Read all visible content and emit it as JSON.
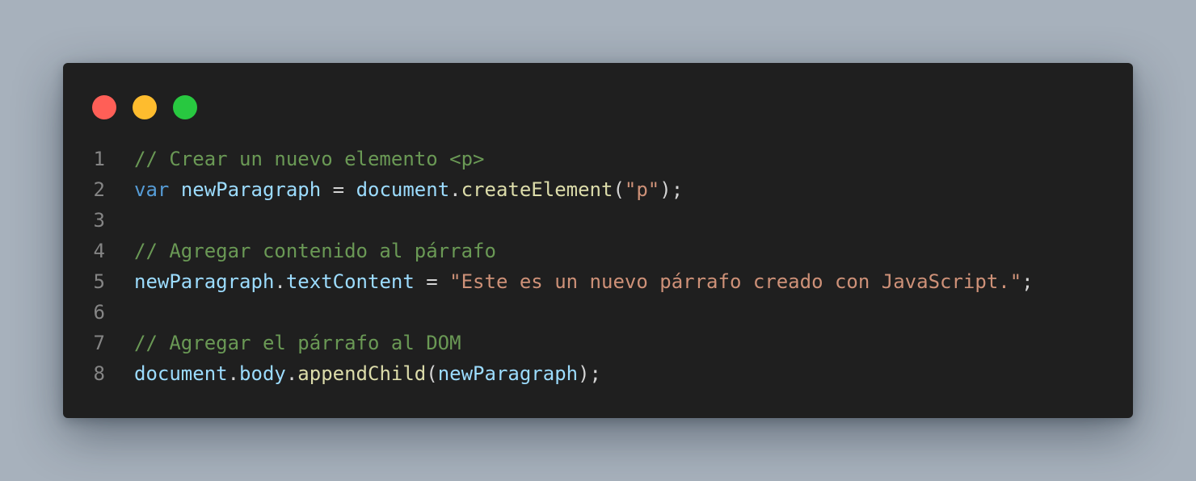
{
  "colors": {
    "background": "#a7b1bc",
    "window": "#1f1f1f",
    "dot_close": "#ff5f57",
    "dot_minimize": "#febc2e",
    "dot_maximize": "#28c840",
    "comment": "#6a9955",
    "keyword": "#569cd6",
    "variable": "#9cdcfe",
    "function": "#dcdcaa",
    "string": "#ce9178",
    "punctuation": "#d4d4d4",
    "line_number": "#858585"
  },
  "window_controls": [
    {
      "name": "close",
      "color": "#ff5f57"
    },
    {
      "name": "minimize",
      "color": "#febc2e"
    },
    {
      "name": "maximize",
      "color": "#28c840"
    }
  ],
  "code_lines": [
    {
      "number": "1",
      "tokens": [
        {
          "type": "comment",
          "text": "// Crear un nuevo elemento <p>"
        }
      ]
    },
    {
      "number": "2",
      "tokens": [
        {
          "type": "keyword",
          "text": "var"
        },
        {
          "type": "punct",
          "text": " "
        },
        {
          "type": "variable",
          "text": "newParagraph"
        },
        {
          "type": "punct",
          "text": " = "
        },
        {
          "type": "variable",
          "text": "document"
        },
        {
          "type": "punct",
          "text": "."
        },
        {
          "type": "function",
          "text": "createElement"
        },
        {
          "type": "punct",
          "text": "("
        },
        {
          "type": "string",
          "text": "\"p\""
        },
        {
          "type": "punct",
          "text": ");"
        }
      ]
    },
    {
      "number": "3",
      "tokens": []
    },
    {
      "number": "4",
      "tokens": [
        {
          "type": "comment",
          "text": "// Agregar contenido al párrafo"
        }
      ]
    },
    {
      "number": "5",
      "tokens": [
        {
          "type": "variable",
          "text": "newParagraph"
        },
        {
          "type": "punct",
          "text": "."
        },
        {
          "type": "variable",
          "text": "textContent"
        },
        {
          "type": "punct",
          "text": " = "
        },
        {
          "type": "string",
          "text": "\"Este es un nuevo párrafo creado con JavaScript.\""
        },
        {
          "type": "punct",
          "text": ";"
        }
      ]
    },
    {
      "number": "6",
      "tokens": []
    },
    {
      "number": "7",
      "tokens": [
        {
          "type": "comment",
          "text": "// Agregar el párrafo al DOM"
        }
      ]
    },
    {
      "number": "8",
      "tokens": [
        {
          "type": "variable",
          "text": "document"
        },
        {
          "type": "punct",
          "text": "."
        },
        {
          "type": "variable",
          "text": "body"
        },
        {
          "type": "punct",
          "text": "."
        },
        {
          "type": "function",
          "text": "appendChild"
        },
        {
          "type": "punct",
          "text": "("
        },
        {
          "type": "variable",
          "text": "newParagraph"
        },
        {
          "type": "punct",
          "text": ");"
        }
      ]
    }
  ]
}
